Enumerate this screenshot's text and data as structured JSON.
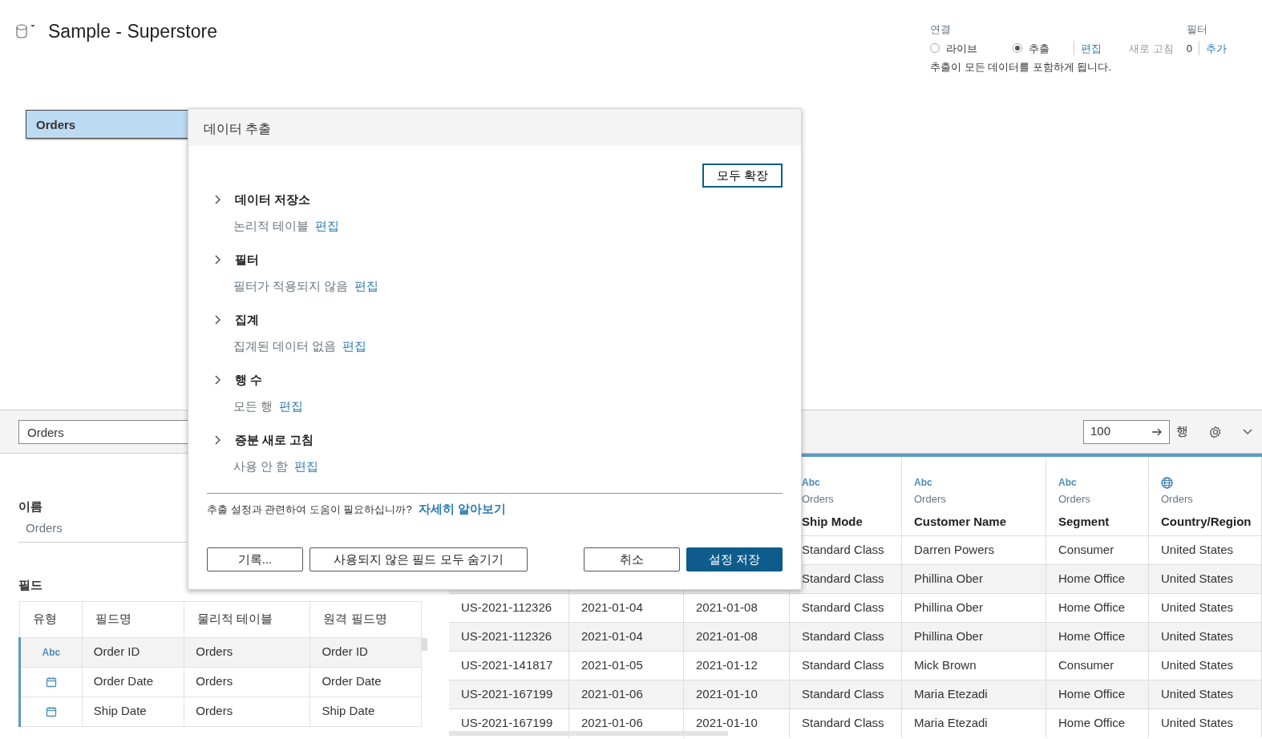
{
  "header": {
    "title": "Sample - Superstore"
  },
  "connection": {
    "label": "연결",
    "options": [
      {
        "label": "라이브",
        "selected": false
      },
      {
        "label": "추출",
        "selected": true
      }
    ],
    "edit_link": "편집",
    "refresh": {
      "label": "새로 고침",
      "disabled": true
    },
    "note": "추출이 모든 데이터를 포함하게 됩니다."
  },
  "filters": {
    "label": "필터",
    "count": "0",
    "add_link": "추가"
  },
  "canvas": {
    "tables": [
      {
        "name": "Orders",
        "selected": true
      }
    ]
  },
  "toolbar": {
    "table_field": "Orders",
    "rows_value": "100",
    "rows_unit": "행"
  },
  "details": {
    "name_label": "이름",
    "name_value": "Orders",
    "fields_label": "필드",
    "columns": [
      "유형",
      "필드명",
      "물리적 테이블",
      "원격 필드명"
    ],
    "rows": [
      {
        "kind": "string",
        "type_label": "Abc",
        "field": "Order ID",
        "table": "Orders",
        "remote": "Order ID",
        "selected": true
      },
      {
        "kind": "date",
        "field": "Order Date",
        "table": "Orders",
        "remote": "Order Date",
        "selected": false
      },
      {
        "kind": "date",
        "field": "Ship Date",
        "table": "Orders",
        "remote": "Ship Date",
        "selected": false
      }
    ]
  },
  "grid": {
    "columns": [
      {
        "kind": "string",
        "type_label": "Abc",
        "table": "Orders",
        "name": "Ship Mode"
      },
      {
        "kind": "string",
        "type_label": "Abc",
        "table": "Orders",
        "name": "Customer Name"
      },
      {
        "kind": "string",
        "type_label": "Abc",
        "table": "Orders",
        "name": "Segment"
      },
      {
        "kind": "geo",
        "table": "Orders",
        "name": "Country/Region"
      }
    ],
    "rows": [
      {
        "cells": [
          "Standard Class",
          "Darren Powers",
          "Consumer",
          "United States"
        ]
      },
      {
        "cells": [
          "Standard Class",
          "Phillina Ober",
          "Home Office",
          "United States"
        ]
      },
      {
        "cells": [
          "US-2021-112326",
          "2021-01-04",
          "2021-01-08",
          "Standard Class",
          "Phillina Ober",
          "Home Office",
          "United States"
        ]
      },
      {
        "cells": [
          "US-2021-112326",
          "2021-01-04",
          "2021-01-08",
          "Standard Class",
          "Phillina Ober",
          "Home Office",
          "United States"
        ]
      },
      {
        "cells": [
          "US-2021-141817",
          "2021-01-05",
          "2021-01-12",
          "Standard Class",
          "Mick Brown",
          "Consumer",
          "United States"
        ]
      },
      {
        "cells": [
          "US-2021-167199",
          "2021-01-06",
          "2021-01-10",
          "Standard Class",
          "Maria Etezadi",
          "Home Office",
          "United States"
        ]
      },
      {
        "cells": [
          "US-2021-167199",
          "2021-01-06",
          "2021-01-10",
          "Standard Class",
          "Maria Etezadi",
          "Home Office",
          "United States"
        ]
      }
    ]
  },
  "dialog": {
    "title": "데이터 추출",
    "expand_all": "모두 확장",
    "sections": [
      {
        "title": "데이터 저장소",
        "summary": "논리적 테이블",
        "edit": "편집",
        "expanded": false
      },
      {
        "title": "필터",
        "summary": "필터가 적용되지 않음",
        "edit": "편집",
        "expanded": false
      },
      {
        "title": "집계",
        "summary": "집계된 데이터 없음",
        "edit": "편집",
        "expanded": false
      },
      {
        "title": "행 수",
        "summary": "모든 행",
        "edit": "편집",
        "expanded": false
      },
      {
        "title": "증분 새로 고침",
        "summary": "사용 안 함",
        "edit": "편집",
        "expanded": false
      }
    ],
    "help_text": "추출 설정과 관련하여 도움이 필요하십니까?",
    "help_link": "자세히 알아보기",
    "buttons_left": [
      {
        "label": "기록...",
        "kind": "secondary"
      },
      {
        "label": "사용되지 않은 필드 모두 숨기기",
        "kind": "secondary"
      }
    ],
    "buttons_right": [
      {
        "label": "취소",
        "kind": "secondary"
      },
      {
        "label": "설정 저장",
        "kind": "primary"
      }
    ]
  }
}
